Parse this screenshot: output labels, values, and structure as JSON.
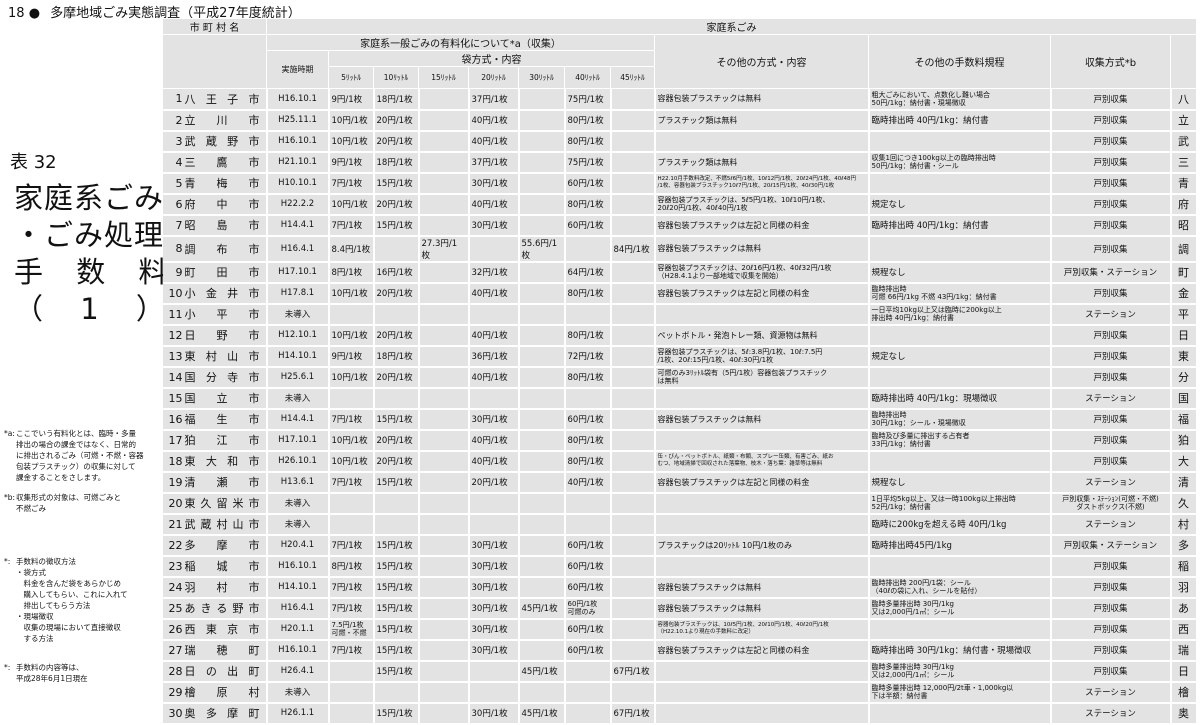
{
  "page_header": {
    "page_no": "18",
    "bullet": "●",
    "title": "多摩地域ごみ実態調査（平成27年度統計）"
  },
  "side": {
    "table_no": "表 32",
    "title_lines": [
      "家庭系ごみ",
      "・ごみ処理",
      "手 数 料",
      "（ 1 ）"
    ]
  },
  "notes": [
    {
      "mark": "*a:",
      "text": "ここでいう有料化とは、臨時・多量\n排出の場合の課金ではなく、日常的\nに排出されるごみ（可燃・不燃・容器\n包装プラスチック）の収集に対して\n課金することをさします。"
    },
    {
      "mark": "*b:",
      "text": "収集形式の対象は、可燃ごみと\n不燃ごみ"
    },
    {
      "mark": "*:",
      "text": "手数料の徴収方法\n・袋方式\n　料金を含んだ袋をあらかじめ\n　購入してもらい、これに入れて\n　排出してもらう方法\n・現場徴収\n　収集の現場において直接徴収\n　する方法"
    },
    {
      "mark": "*:",
      "text": "手数料の内容等は、\n平成28年6月1日現在"
    }
  ],
  "header": {
    "col_city": "市 町 村 名",
    "katei": "家庭系ごみ",
    "yuryo": "家庭系一般ごみの有料化について*a（収集）",
    "bag_method": "袋方式・内容",
    "impl": "実施時期",
    "sizes": [
      "5ﾘｯﾄﾙ",
      "10ﾘｯﾄﾙ",
      "15ﾘｯﾄﾙ",
      "20ﾘｯﾄﾙ",
      "30ﾘｯﾄﾙ",
      "40ﾘｯﾄﾙ",
      "45ﾘｯﾄﾙ"
    ],
    "other_method": "その他の方式・内容",
    "other_fee": "その他の手数料規程",
    "collection": "収集方式*b"
  },
  "rows": [
    {
      "no": "1",
      "name": "八王子市",
      "impl": "H16.10.1",
      "fees": [
        "9円/1枚",
        "18円/1枚",
        "",
        "37円/1枚",
        "",
        "75円/1枚",
        ""
      ],
      "other": "容器包装プラスチックは無料",
      "fee_rule": "粗大ごみにおいて、点数化し難い場合\n50円/1kg：納付書・現場徴収",
      "coll": "戸別収集",
      "init": "八"
    },
    {
      "no": "2",
      "name": "立川市",
      "impl": "H25.11.1",
      "fees": [
        "10円/1枚",
        "20円/1枚",
        "",
        "40円/1枚",
        "",
        "80円/1枚",
        ""
      ],
      "other": "プラスチック類は無料",
      "fee_rule": "臨時排出時 40円/1kg：納付書",
      "coll": "戸別収集",
      "init": "立"
    },
    {
      "no": "3",
      "name": "武蔵野市",
      "impl": "H16.10.1",
      "fees": [
        "10円/1枚",
        "20円/1枚",
        "",
        "40円/1枚",
        "",
        "80円/1枚",
        ""
      ],
      "other": "",
      "fee_rule": "",
      "coll": "戸別収集",
      "init": "武"
    },
    {
      "no": "4",
      "name": "三鷹市",
      "impl": "H21.10.1",
      "fees": [
        "9円/1枚",
        "18円/1枚",
        "",
        "37円/1枚",
        "",
        "75円/1枚",
        ""
      ],
      "other": "プラスチック類は無料",
      "fee_rule": "収集1回につき100kg以上の臨時排出時\n50円/1kg：納付書・シール",
      "coll": "戸別収集",
      "init": "三"
    },
    {
      "no": "5",
      "name": "青梅市",
      "impl": "H10.10.1",
      "fees": [
        "7円/1枚",
        "15円/1枚",
        "",
        "30円/1枚",
        "",
        "60円/1枚",
        ""
      ],
      "other": "H22.10月手数料改定、不燃5ℓ6円/1枚、10ℓ12円/1枚、20ℓ24円/1枚、40ℓ48円\n/1枚、容器包装プラスチック10ℓ7円/1枚、20ℓ15円/1枚、40ℓ30円/1枚",
      "fee_rule": "",
      "coll": "戸別収集",
      "init": "青"
    },
    {
      "no": "6",
      "name": "府中市",
      "impl": "H22.2.2",
      "fees": [
        "10円/1枚",
        "20円/1枚",
        "",
        "40円/1枚",
        "",
        "80円/1枚",
        ""
      ],
      "other": "容器包装プラスチックは、5ℓ5円/1枚、10ℓ10円/1枚、\n20ℓ20円/1枚、40ℓ40円/1枚",
      "fee_rule": "規定なし",
      "coll": "戸別収集",
      "init": "府"
    },
    {
      "no": "7",
      "name": "昭島市",
      "impl": "H14.4.1",
      "fees": [
        "7円/1枚",
        "15円/1枚",
        "",
        "30円/1枚",
        "",
        "60円/1枚",
        ""
      ],
      "other": "容器包装プラスチックは左記と同様の料金",
      "fee_rule": "臨時排出時 40円/1kg：納付書",
      "coll": "戸別収集",
      "init": "昭"
    },
    {
      "no": "8",
      "name": "調布市",
      "impl": "H16.4.1",
      "fees": [
        "8.4円/1枚",
        "",
        "27.3円/1枚",
        "",
        "55.6円/1枚",
        "",
        "84円/1枚"
      ],
      "other": "容器包装プラスチックは無料",
      "fee_rule": "",
      "coll": "戸別収集",
      "init": "調"
    },
    {
      "no": "9",
      "name": "町田市",
      "impl": "H17.10.1",
      "fees": [
        "8円/1枚",
        "16円/1枚",
        "",
        "32円/1枚",
        "",
        "64円/1枚",
        ""
      ],
      "other": "容器包装プラスチックは、20ℓ16円/1枚、40ℓ32円/1枚\n（H28.4.1より一部地域で収集を開始）",
      "fee_rule": "規程なし",
      "coll": "戸別収集・ステーション",
      "init": "町"
    },
    {
      "no": "10",
      "name": "小金井市",
      "impl": "H17.8.1",
      "fees": [
        "10円/1枚",
        "20円/1枚",
        "",
        "40円/1枚",
        "",
        "80円/1枚",
        ""
      ],
      "other": "容器包装プラスチックは左記と同様の料金",
      "fee_rule": "臨時排出時\n可燃 66円/1kg 不燃 43円/1kg：納付書",
      "coll": "戸別収集",
      "init": "金"
    },
    {
      "no": "11",
      "name": "小平市",
      "impl": "未導入",
      "fees": [
        "",
        "",
        "",
        "",
        "",
        "",
        ""
      ],
      "other": "",
      "fee_rule": "一日平均10kg以上又は臨時に200kg以上\n排出時 40円/1kg：納付書",
      "coll": "ステーション",
      "init": "平"
    },
    {
      "no": "12",
      "name": "日野市",
      "impl": "H12.10.1",
      "fees": [
        "10円/1枚",
        "20円/1枚",
        "",
        "40円/1枚",
        "",
        "80円/1枚",
        ""
      ],
      "other": "ペットボトル・発泡トレー類、資源物は無料",
      "fee_rule": "",
      "coll": "戸別収集",
      "init": "日"
    },
    {
      "no": "13",
      "name": "東村山市",
      "impl": "H14.10.1",
      "fees": [
        "9円/1枚",
        "18円/1枚",
        "",
        "36円/1枚",
        "",
        "72円/1枚",
        ""
      ],
      "other": "容器包装プラスチックは、5ℓ:3.8円/1枚、10ℓ:7.5円\n/1枚、20ℓ:15円/1枚、40ℓ:30円/1枚",
      "fee_rule": "規定なし",
      "coll": "戸別収集",
      "init": "東"
    },
    {
      "no": "14",
      "name": "国分寺市",
      "impl": "H25.6.1",
      "fees": [
        "10円/1枚",
        "20円/1枚",
        "",
        "40円/1枚",
        "",
        "80円/1枚",
        ""
      ],
      "other": "可燃のみ3ﾘｯﾄﾙ袋有（5円/1枚）容器包装プラスチック\nは無料",
      "fee_rule": "",
      "coll": "戸別収集",
      "init": "分"
    },
    {
      "no": "15",
      "name": "国立市",
      "impl": "未導入",
      "fees": [
        "",
        "",
        "",
        "",
        "",
        "",
        ""
      ],
      "other": "",
      "fee_rule": "臨時排出時 40円/1kg：現場徴収",
      "coll": "ステーション",
      "init": "国"
    },
    {
      "no": "16",
      "name": "福生市",
      "impl": "H14.4.1",
      "fees": [
        "7円/1枚",
        "15円/1枚",
        "",
        "30円/1枚",
        "",
        "60円/1枚",
        ""
      ],
      "other": "容器包装プラスチックは無料",
      "fee_rule": "臨時排出時\n30円/1kg：シール・現場徴収",
      "coll": "戸別収集",
      "init": "福"
    },
    {
      "no": "17",
      "name": "狛江市",
      "impl": "H17.10.1",
      "fees": [
        "10円/1枚",
        "20円/1枚",
        "",
        "40円/1枚",
        "",
        "80円/1枚",
        ""
      ],
      "other": "",
      "fee_rule": "臨時及び多量に排出する占有者\n33円/1kg：納付書",
      "coll": "戸別収集",
      "init": "狛"
    },
    {
      "no": "18",
      "name": "東大和市",
      "impl": "H26.10.1",
      "fees": [
        "10円/1枚",
        "20円/1枚",
        "",
        "40円/1枚",
        "",
        "80円/1枚",
        ""
      ],
      "other": "缶・びん・ペットボトル、紙類・布類、スプレー缶類、有害ごみ、紙お\nむつ、地域清掃で回収された落葉物、枝木・落ち葉：雑草等は無料",
      "fee_rule": "",
      "coll": "戸別収集",
      "init": "大"
    },
    {
      "no": "19",
      "name": "清瀬市",
      "impl": "H13.6.1",
      "fees": [
        "7円/1枚",
        "15円/1枚",
        "",
        "20円/1枚",
        "",
        "40円/1枚",
        ""
      ],
      "other": "容器包装プラスチックは左記と同様の料金",
      "fee_rule": "規程なし",
      "coll": "ステーション",
      "init": "清"
    },
    {
      "no": "20",
      "name": "東久留米市",
      "impl": "未導入",
      "fees": [
        "",
        "",
        "",
        "",
        "",
        "",
        ""
      ],
      "other": "",
      "fee_rule": "1日平均5kg以上、又は一時100kg以上排出時\n52円/1kg：納付書",
      "coll": "戸別収集・ｽﾃｰｼｮﾝ(可燃・不燃)\nダストボックス(不燃)",
      "init": "久"
    },
    {
      "no": "21",
      "name": "武蔵村山市",
      "impl": "未導入",
      "fees": [
        "",
        "",
        "",
        "",
        "",
        "",
        ""
      ],
      "other": "",
      "fee_rule": "臨時に200kgを超える時 40円/1kg",
      "coll": "ステーション",
      "init": "村"
    },
    {
      "no": "22",
      "name": "多摩市",
      "impl": "H20.4.1",
      "fees": [
        "7円/1枚",
        "15円/1枚",
        "",
        "30円/1枚",
        "",
        "60円/1枚",
        ""
      ],
      "other": "プラスチックは20ﾘｯﾄﾙ 10円/1枚のみ",
      "fee_rule": "臨時排出時45円/1kg",
      "coll": "戸別収集・ステーション",
      "init": "多"
    },
    {
      "no": "23",
      "name": "稲城市",
      "impl": "H16.10.1",
      "fees": [
        "8円/1枚",
        "15円/1枚",
        "",
        "30円/1枚",
        "",
        "60円/1枚",
        ""
      ],
      "other": "",
      "fee_rule": "",
      "coll": "戸別収集",
      "init": "稲"
    },
    {
      "no": "24",
      "name": "羽村市",
      "impl": "H14.10.1",
      "fees": [
        "7円/1枚",
        "15円/1枚",
        "",
        "30円/1枚",
        "",
        "60円/1枚",
        ""
      ],
      "other": "容器包装プラスチックは無料",
      "fee_rule": "臨時排出時 200円/1袋：シール\n（40ℓの袋に入れ、シールを貼付）",
      "coll": "戸別収集",
      "init": "羽"
    },
    {
      "no": "25",
      "name": "あきる野市",
      "impl": "H16.4.1",
      "fees": [
        "7円/1枚",
        "15円/1枚",
        "",
        "30円/1枚",
        "45円/1枚",
        "60円/1枚\n可燃のみ",
        ""
      ],
      "other": "容器包装プラスチックは無料",
      "fee_rule": "臨時多量排出時 30円/1kg\n又は2,000円/1㎥：シール",
      "coll": "戸別収集",
      "init": "あ"
    },
    {
      "no": "26",
      "name": "西東京市",
      "impl": "H20.1.1",
      "fees": [
        "7.5円/1枚\n可燃・不燃",
        "15円/1枚",
        "",
        "30円/1枚",
        "",
        "60円/1枚",
        ""
      ],
      "other": "容器包装プラスチックは、10ℓ5円/1枚、20ℓ10円/1枚、40ℓ20円/1枚\n（H22.10.1より現在の手数料に改定）",
      "fee_rule": "",
      "coll": "戸別収集",
      "init": "西"
    },
    {
      "no": "27",
      "name": "瑞穂町",
      "impl": "H16.10.1",
      "fees": [
        "7円/1枚",
        "15円/1枚",
        "",
        "30円/1枚",
        "",
        "60円/1枚",
        ""
      ],
      "other": "容器包装プラスチックは左記と同様の料金",
      "fee_rule": "臨時排出時 30円/1kg：納付書・現場徴収",
      "coll": "戸別収集",
      "init": "瑞"
    },
    {
      "no": "28",
      "name": "日の出町",
      "impl": "H26.4.1",
      "fees": [
        "",
        "15円/1枚",
        "",
        "",
        "45円/1枚",
        "",
        "67円/1枚"
      ],
      "other": "",
      "fee_rule": "臨時多量排出時 30円/1kg\n又は2,000円/1㎥：シール",
      "coll": "戸別収集",
      "init": "日"
    },
    {
      "no": "29",
      "name": "檜原村",
      "impl": "未導入",
      "fees": [
        "",
        "",
        "",
        "",
        "",
        "",
        ""
      ],
      "other": "",
      "fee_rule": "臨時多量排出時 12,000円/2t車・1,000kg以\n下は半額：納付書",
      "coll": "ステーション",
      "init": "檜"
    },
    {
      "no": "30",
      "name": "奥多摩町",
      "impl": "H26.1.1",
      "fees": [
        "",
        "15円/1枚",
        "",
        "30円/1枚",
        "45円/1枚",
        "",
        "67円/1枚"
      ],
      "other": "",
      "fee_rule": "",
      "coll": "ステーション",
      "init": "奥"
    }
  ]
}
